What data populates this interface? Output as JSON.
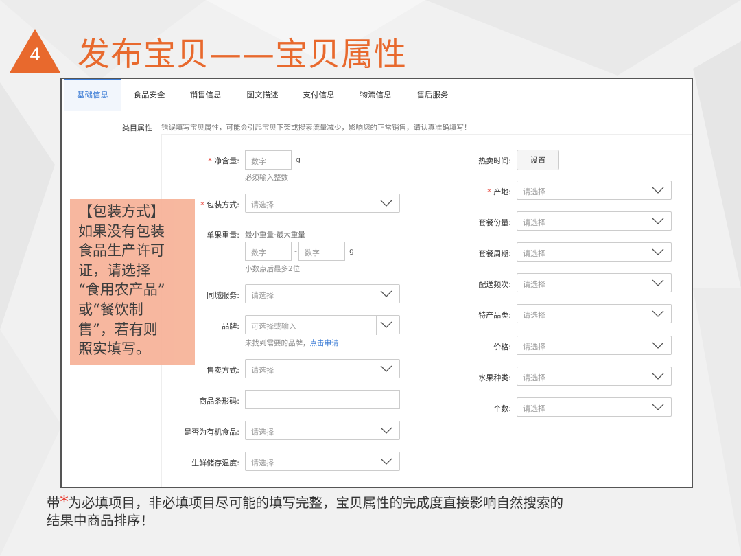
{
  "slide": {
    "step_number": "4",
    "title": "发布宝贝——宝贝属性",
    "accent_color": "#e8692d"
  },
  "tabs": [
    "基础信息",
    "食品安全",
    "销售信息",
    "图文描述",
    "支付信息",
    "物流信息",
    "售后服务"
  ],
  "active_tab": "基础信息",
  "category": {
    "label": "类目属性",
    "note": "错误填写宝贝属性，可能会引起宝贝下架或搜索流量减少，影响您的正常销售，请认真准确填写！"
  },
  "form": {
    "net_content": {
      "label": "净含量:",
      "placeholder": "数字",
      "unit": "g",
      "hint": "必须输入整数"
    },
    "packaging": {
      "label": "包装方式:",
      "value": "请选择"
    },
    "unit_weight": {
      "label": "单果重量:",
      "range_label": "最小重量-最大重量",
      "min_placeholder": "数字",
      "sep": "-",
      "max_placeholder": "数字",
      "unit": "g",
      "hint": "小数点后最多2位"
    },
    "local_service": {
      "label": "同城服务:",
      "value": "请选择"
    },
    "brand": {
      "label": "品牌:",
      "placeholder": "可选择或输入",
      "hint": "未找到需要的品牌，",
      "hint_link": "点击申请"
    },
    "sale_method": {
      "label": "售卖方式:",
      "value": "请选择"
    },
    "barcode": {
      "label": "商品条形码:",
      "value": ""
    },
    "organic": {
      "label": "是否为有机食品:",
      "value": "请选择"
    },
    "storage_temp": {
      "label": "生鲜储存温度:",
      "value": "请选择"
    },
    "hot_time": {
      "label": "热卖时间:",
      "button": "设置"
    },
    "origin": {
      "label": "产地:",
      "value": "请选择"
    },
    "package_count": {
      "label": "套餐份量:",
      "value": "请选择"
    },
    "package_period": {
      "label": "套餐周期:",
      "value": "请选择"
    },
    "delivery_freq": {
      "label": "配送频次:",
      "value": "请选择"
    },
    "specialty": {
      "label": "特产品类:",
      "value": "请选择"
    },
    "price": {
      "label": "价格:",
      "value": "请选择"
    },
    "fruit_type": {
      "label": "水果种类:",
      "value": "请选择"
    },
    "count": {
      "label": "个数:",
      "value": "请选择"
    }
  },
  "callout": {
    "text": "【包装方式】\n如果没有包装\n食品生产许可\n证，请选择\n“食用农产品”\n或“餐饮制\n售”，若有则\n照实填写。"
  },
  "footer": {
    "prefix": "带",
    "star": "*",
    "line1_rest": "为必填项目，非必填项目尽可能的填写完整，宝贝属性的完成度直接影响自然搜索的",
    "line2": "结果中商品排序！"
  },
  "icons": {
    "dropdown": "chevron-down-icon"
  }
}
